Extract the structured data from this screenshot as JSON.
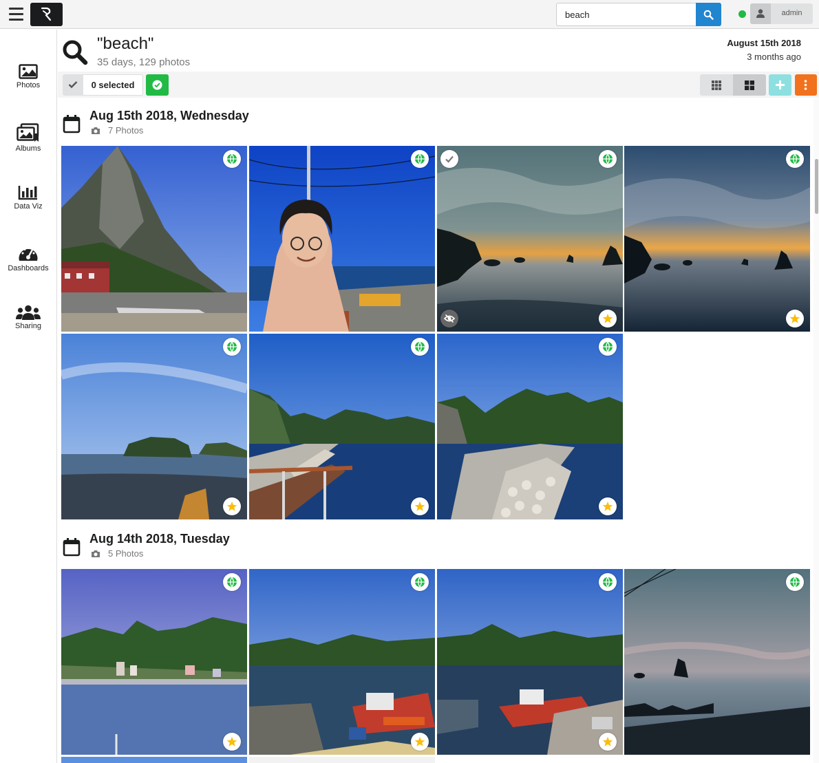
{
  "search": {
    "value": "beach"
  },
  "user": {
    "name": "admin"
  },
  "sidebar": {
    "items": [
      {
        "label": "Photos"
      },
      {
        "label": "Albums"
      },
      {
        "label": "Data Viz"
      },
      {
        "label": "Dashboards"
      },
      {
        "label": "Sharing"
      }
    ]
  },
  "header": {
    "title": "\"beach\"",
    "subtitle": "35 days, 129 photos",
    "date": "August 15th 2018",
    "relative": "3 months ago"
  },
  "toolbar": {
    "selected_label": "0 selected"
  },
  "days": [
    {
      "title": "Aug 15th 2018, Wednesday",
      "count": "7 Photos"
    },
    {
      "title": "Aug 14th 2018, Tuesday",
      "count": "5 Photos"
    }
  ],
  "colors": {
    "accent_blue": "#2185d0",
    "online_green": "#21ba45",
    "add_teal": "#8ee0e0",
    "menu_orange": "#f2711c",
    "favorite_star": "#fbbd08",
    "public_globe": "#21ba45"
  },
  "icons": [
    "hamburger-icon",
    "logo-icon",
    "search-icon",
    "user-icon",
    "photos-icon",
    "albums-icon",
    "data-viz-icon",
    "dashboards-icon",
    "sharing-icon",
    "calendar-icon",
    "camera-icon",
    "globe-icon",
    "star-icon",
    "check-icon",
    "hidden-eye-icon",
    "grid-small-icon",
    "grid-large-icon",
    "plus-icon",
    "ellipsis-vertical-icon"
  ]
}
